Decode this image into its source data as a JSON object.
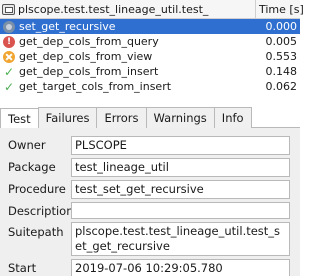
{
  "results": {
    "header": {
      "test_label": "plscope.test.test_lineage_util.test_",
      "time_label": "Time [s]"
    },
    "rows": [
      {
        "icon": "status-icon",
        "name": "set_get_recursive",
        "time": "0.000",
        "selected": true
      },
      {
        "icon": "error-icon",
        "name": "get_dep_cols_from_query",
        "time": "0.005"
      },
      {
        "icon": "warning-icon",
        "name": "get_dep_cols_from_view",
        "time": "0.553"
      },
      {
        "icon": "success-icon",
        "name": "get_dep_cols_from_insert",
        "time": "0.148"
      },
      {
        "icon": "success-icon",
        "name": "get_target_cols_from_insert",
        "time": "0.062"
      }
    ]
  },
  "tabs": [
    "Test",
    "Failures",
    "Errors",
    "Warnings",
    "Info"
  ],
  "details": {
    "owner_label": "Owner",
    "owner_value": "PLSCOPE",
    "package_label": "Package",
    "package_value": "test_lineage_util",
    "procedure_label": "Procedure",
    "procedure_value": "test_set_get_recursive",
    "description_label": "Description",
    "description_value": "",
    "suitepath_label": "Suitepath",
    "suitepath_value": "plscope.test.test_lineage_util.test_set_get_recursive",
    "start_label": "Start",
    "start_value": "2019-07-06 10:29:05.780"
  },
  "colors": {
    "selection": "#2f6fcf",
    "error": "#d9534f",
    "warning": "#f0a530",
    "success": "#4caf50"
  }
}
